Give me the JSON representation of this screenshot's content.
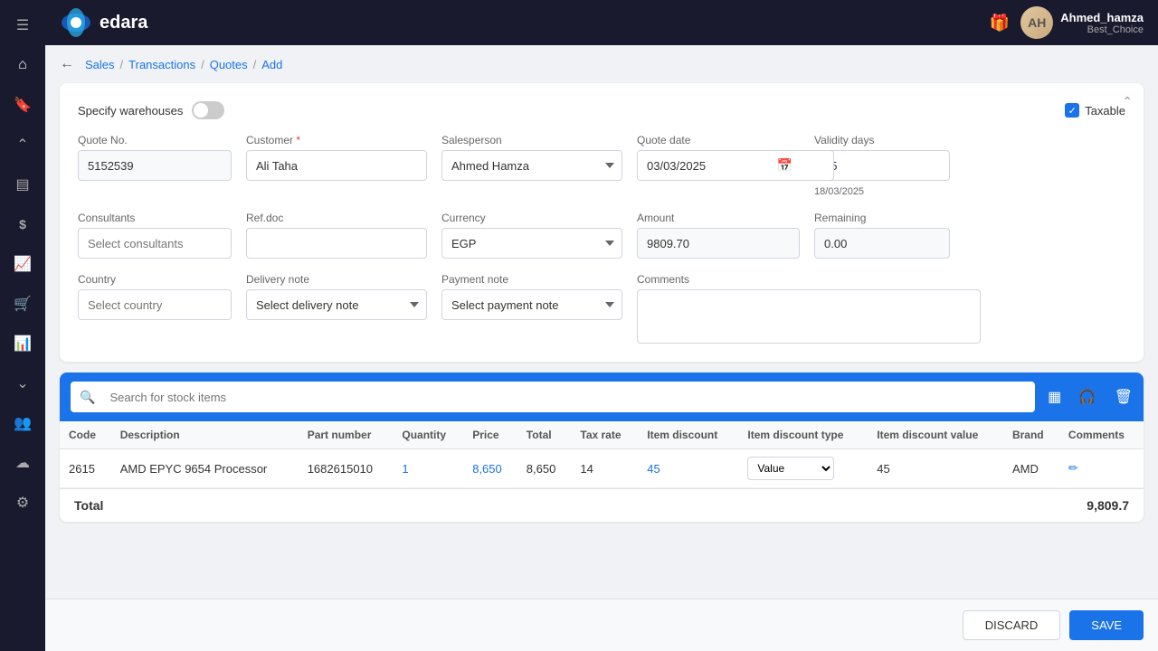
{
  "topbar": {
    "hamburger_label": "☰",
    "logo_text": "edara",
    "gift_icon": "🎁",
    "user_name": "Ahmed_hamza",
    "user_role": "Best_Choice",
    "avatar_initials": "AH"
  },
  "sidebar": {
    "items": [
      {
        "icon": "⌂",
        "name": "home-icon",
        "label": "Home"
      },
      {
        "icon": "🔖",
        "name": "bookmark-icon",
        "label": "Bookmarks"
      },
      {
        "icon": "⌃",
        "name": "collapse-icon",
        "label": "Collapse"
      },
      {
        "icon": "▤",
        "name": "grid-icon",
        "label": "Grid"
      },
      {
        "icon": "$",
        "name": "dollar-icon",
        "label": "Finance"
      },
      {
        "icon": "📈",
        "name": "chart-icon",
        "label": "Analytics"
      },
      {
        "icon": "🛒",
        "name": "cart-icon",
        "label": "Sales"
      },
      {
        "icon": "📊",
        "name": "reports-icon",
        "label": "Reports"
      },
      {
        "icon": "⌄",
        "name": "expand-icon",
        "label": "Expand"
      },
      {
        "icon": "👥",
        "name": "users-icon",
        "label": "Users"
      },
      {
        "icon": "☁",
        "name": "cloud-icon",
        "label": "Cloud"
      },
      {
        "icon": "⚙",
        "name": "settings-icon",
        "label": "Settings"
      }
    ]
  },
  "breadcrumb": {
    "items": [
      "Sales",
      "Transactions",
      "Quotes",
      "Add"
    ],
    "links": [
      "Sales",
      "Transactions",
      "Quotes"
    ],
    "current": "Add"
  },
  "form": {
    "specify_warehouses_label": "Specify warehouses",
    "taxable_label": "Taxable",
    "quote_no_label": "Quote No.",
    "quote_no_value": "5152539",
    "customer_label": "Customer",
    "customer_value": "Ali Taha",
    "salesperson_label": "Salesperson",
    "salesperson_value": "Ahmed Hamza",
    "quote_date_label": "Quote date",
    "quote_date_value": "03/03/2025",
    "validity_days_label": "Validity days",
    "validity_days_value": "15",
    "validity_date_sub": "18/03/2025",
    "consultants_label": "Consultants",
    "consultants_placeholder": "Select consultants",
    "ref_doc_label": "Ref.doc",
    "ref_doc_value": "",
    "currency_label": "Currency",
    "currency_value": "EGP",
    "amount_label": "Amount",
    "amount_value": "9809.70",
    "remaining_label": "Remaining",
    "remaining_value": "0.00",
    "country_label": "Country",
    "country_placeholder": "Select country",
    "delivery_note_label": "Delivery note",
    "delivery_note_placeholder": "Select delivery note",
    "payment_note_label": "Payment note",
    "payment_note_placeholder": "Select payment note",
    "comments_label": "Comments",
    "comments_value": ""
  },
  "items_section": {
    "search_placeholder": "Search for stock items",
    "columns": [
      "Code",
      "Description",
      "Part number",
      "Quantity",
      "Price",
      "Total",
      "Tax rate",
      "Item discount",
      "Item discount type",
      "Item discount value",
      "Brand",
      "Comments"
    ],
    "rows": [
      {
        "code": "2615",
        "description": "AMD EPYC 9654 Processor",
        "part_number": "1682615010",
        "quantity": "1",
        "price": "8,650",
        "total": "8,650",
        "tax_rate": "14",
        "item_discount": "45",
        "item_discount_type": "Value",
        "item_discount_value": "45",
        "brand": "AMD",
        "comments": ""
      }
    ],
    "total_label": "Total",
    "total_value": "9,809.7"
  },
  "footer": {
    "discard_label": "DISCARD",
    "save_label": "SAVE"
  }
}
